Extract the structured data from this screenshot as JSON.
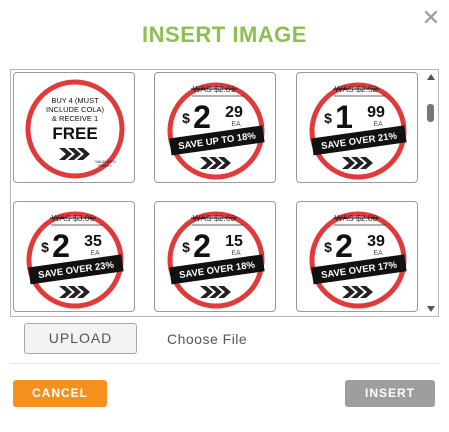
{
  "dialog": {
    "title": "INSERT IMAGE",
    "close_icon": "close-icon",
    "close_glyph": "✕"
  },
  "gallery": {
    "images": [
      {
        "kind": "promo",
        "lines": [
          "BUY 4 (MUST",
          "INCLUDE COLA)",
          "& RECEIVE 1"
        ],
        "headline": "FREE",
        "fineprint": [
          "*VALID WITH",
          "PURCH."
        ]
      },
      {
        "kind": "price",
        "was": "WAS $2.81",
        "dollars": "2",
        "cents": "29",
        "unit": "EA",
        "save": "SAVE UP TO 18%"
      },
      {
        "kind": "price",
        "was": "WAS $2.52",
        "dollars": "1",
        "cents": "99",
        "unit": "EA",
        "save": "SAVE OVER 21%"
      },
      {
        "kind": "price",
        "was": "WAS $3.06",
        "dollars": "2",
        "cents": "35",
        "unit": "EA",
        "save": "SAVE OVER 23%"
      },
      {
        "kind": "price",
        "was": "WAS $2.63",
        "dollars": "2",
        "cents": "15",
        "unit": "EA",
        "save": "SAVE OVER 18%"
      },
      {
        "kind": "price",
        "was": "WAS $2.88",
        "dollars": "2",
        "cents": "39",
        "unit": "EA",
        "save": "SAVE OVER 17%"
      }
    ]
  },
  "upload": {
    "button_label": "UPLOAD",
    "file_label": "Choose File"
  },
  "footer": {
    "cancel_label": "CANCEL",
    "insert_label": "INSERT"
  },
  "colors": {
    "title": "#8cc152",
    "cancel": "#f5901e",
    "insert": "#9e9e9e",
    "ring": "#e03a3a"
  }
}
